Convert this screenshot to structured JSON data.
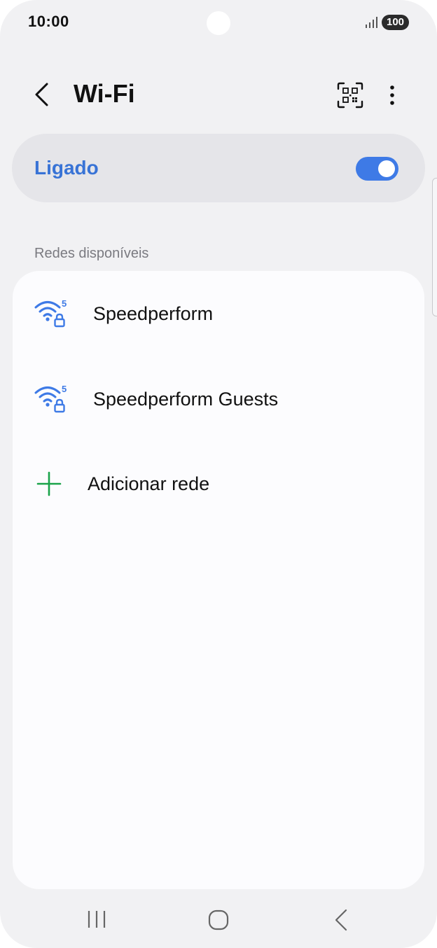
{
  "status_bar": {
    "time": "10:00",
    "battery": "100",
    "icons": [
      "signal-icon"
    ]
  },
  "header": {
    "title": "Wi-Fi",
    "icons": [
      "back-arrow-icon",
      "qr-code-scan-icon",
      "more-options-icon"
    ]
  },
  "wifi_toggle": {
    "label": "Ligado",
    "state": "on"
  },
  "networks": {
    "section_label": "Redes disponíveis",
    "items": [
      {
        "name": "Speedperform",
        "icon": "wifi-5ghz-locked-icon"
      },
      {
        "name": "Speedperform Guests",
        "icon": "wifi-5ghz-locked-icon"
      }
    ],
    "add_network_label": "Adicionar rede",
    "add_network_icon": "plus-icon"
  },
  "nav_bar": {
    "icons": [
      "recents-icon",
      "home-icon",
      "back-icon"
    ]
  },
  "colors": {
    "accent": "#3e7ae6",
    "toggle_label": "#3873d6",
    "add_icon": "#1aa34a",
    "background": "#f1f1f3",
    "card": "#fcfcfe"
  }
}
